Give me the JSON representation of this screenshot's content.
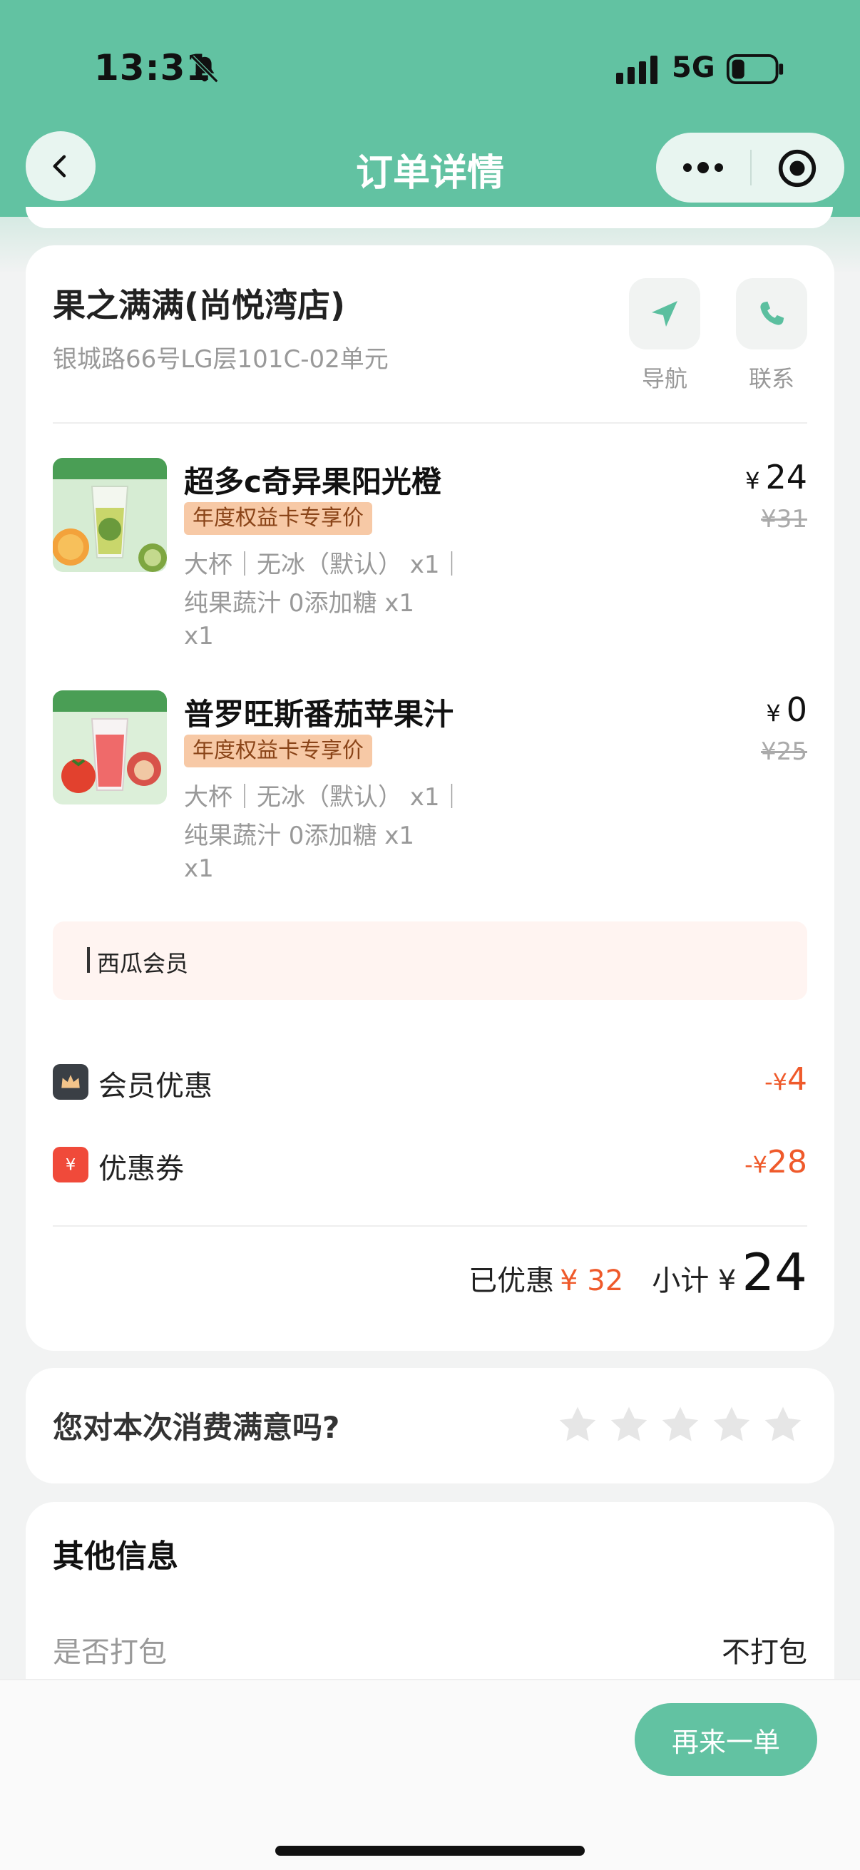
{
  "status_bar": {
    "time": "13:31",
    "network": "5G"
  },
  "header": {
    "title": "订单详情"
  },
  "store": {
    "name": "果之满满(尚悦湾店)",
    "address": "银城路66号LG层101C-02单元",
    "nav_label": "导航",
    "contact_label": "联系"
  },
  "items": [
    {
      "name": "超多c奇异果阳光橙",
      "badge": "年度权益卡专享价",
      "spec_line1": "大杯｜无冰（默认） x1｜",
      "spec_line2": "纯果蔬汁 0添加糖 x1",
      "qty": "x1",
      "price_currency": "¥",
      "price": "24",
      "original_price": "¥31"
    },
    {
      "name": "普罗旺斯番茄苹果汁",
      "badge": "年度权益卡专享价",
      "spec_line1": "大杯｜无冰（默认） x1｜",
      "spec_line2": "纯果蔬汁 0添加糖 x1",
      "qty": "x1",
      "price_currency": "¥",
      "price": "0",
      "original_price": "¥25"
    }
  ],
  "member_bar": {
    "text": "西瓜会员"
  },
  "discounts": [
    {
      "label": "会员优惠",
      "amount_prefix": "-¥",
      "amount": "4",
      "icon": "crown-icon"
    },
    {
      "label": "优惠券",
      "amount_prefix": "-¥",
      "amount": "28",
      "icon": "coupon-icon"
    }
  ],
  "summary": {
    "saved_label": "已优惠",
    "saved_value": "¥ 32",
    "subtotal_label": "小计 ¥",
    "subtotal_value": "24"
  },
  "rating": {
    "question": "您对本次消费满意吗?",
    "stars": 5,
    "selected": 0
  },
  "other_info": {
    "title": "其他信息",
    "packing_label": "是否打包",
    "packing_value": "不打包"
  },
  "actions": {
    "reorder_label": "再来一单"
  },
  "colors": {
    "brand": "#62c2a2",
    "discount": "#ef5a2b",
    "badge_bg": "#f7c9a6"
  }
}
